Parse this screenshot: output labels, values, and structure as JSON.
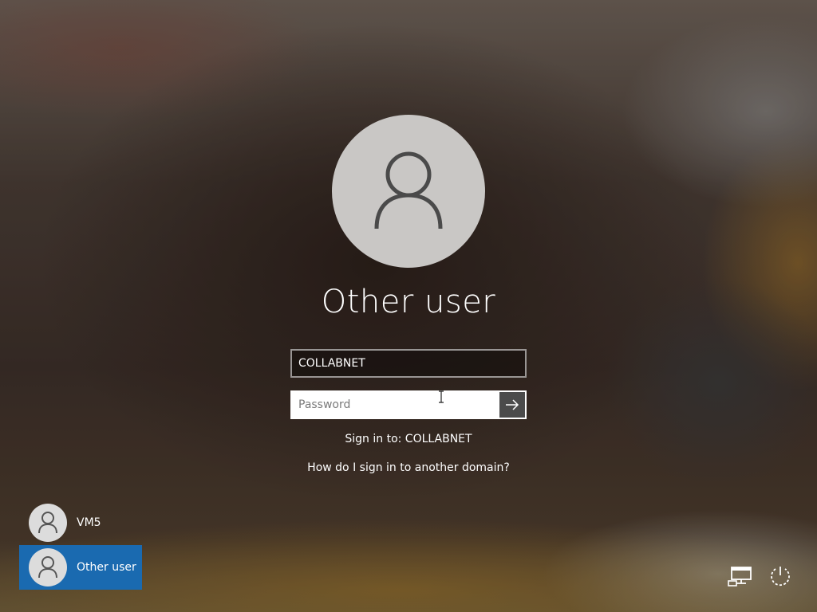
{
  "user": {
    "display_name": "Other user"
  },
  "form": {
    "domain_value": "COLLABNET",
    "password_placeholder": "Password",
    "sign_in_to": "Sign in to: COLLABNET",
    "help_link": "How do I sign in to another domain?"
  },
  "user_list": [
    {
      "name": "VM5",
      "selected": false
    },
    {
      "name": "Other user",
      "selected": true
    }
  ],
  "system_icons": [
    "network-icon",
    "power-icon"
  ],
  "colors": {
    "selected_tile": "#1a6ab0",
    "submit_button": "#4b4b4b"
  }
}
